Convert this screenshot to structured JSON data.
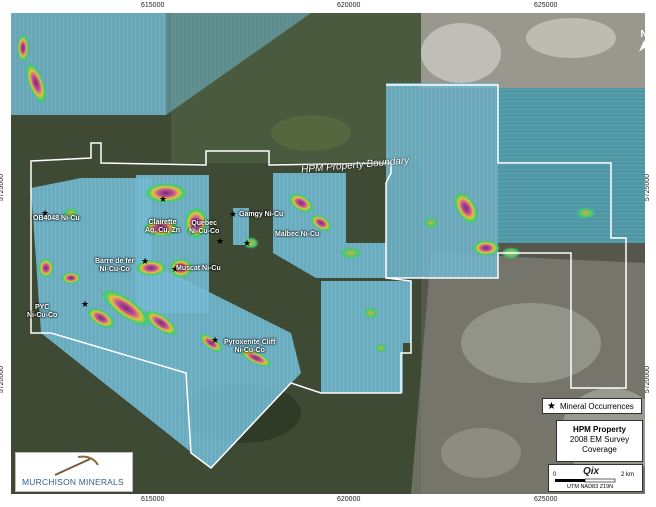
{
  "map": {
    "property_label": "HPM Property Boundary",
    "ticks_top": [
      "615000",
      "620000",
      "625000"
    ],
    "ticks_bottom": [
      "615000",
      "620000",
      "625000"
    ],
    "ticks_left": [
      "5725000",
      "5720000"
    ],
    "ticks_right": [
      "5725000",
      "5720000"
    ],
    "north": "N",
    "occurrences": [
      {
        "lines": [
          "OB4048 Ni-Cu"
        ]
      },
      {
        "lines": [
          "Clairette",
          "Ag, Cu, Zn"
        ]
      },
      {
        "lines": [
          "Gamgy Ni-Cu"
        ]
      },
      {
        "lines": [
          "Quebec",
          "Ni-Cu-Co"
        ]
      },
      {
        "lines": [
          "Malbec Ni-Cu"
        ]
      },
      {
        "lines": [
          "Barre de fer",
          "Ni-Cu-Co"
        ]
      },
      {
        "lines": [
          "Muscat Ni-Cu"
        ]
      },
      {
        "lines": [
          "PYC",
          "Ni-Cu-Co"
        ]
      },
      {
        "lines": [
          "Pyroxenite Cliff",
          "Ni-Cu-Co"
        ]
      }
    ]
  },
  "legend": {
    "star_icon": "star-icon",
    "label": "Mineral Occurrences"
  },
  "title_box": {
    "line1": "HPM Property",
    "line2": "2008 EM Survey",
    "line3": "Coverage"
  },
  "scale": {
    "logo": "Qix",
    "zero": "0",
    "end": "2 km",
    "projection": "UTM NAD83 Z19N"
  },
  "logo": {
    "text": "MURCHISON MINERALS",
    "icon": "pickaxe-icon"
  }
}
